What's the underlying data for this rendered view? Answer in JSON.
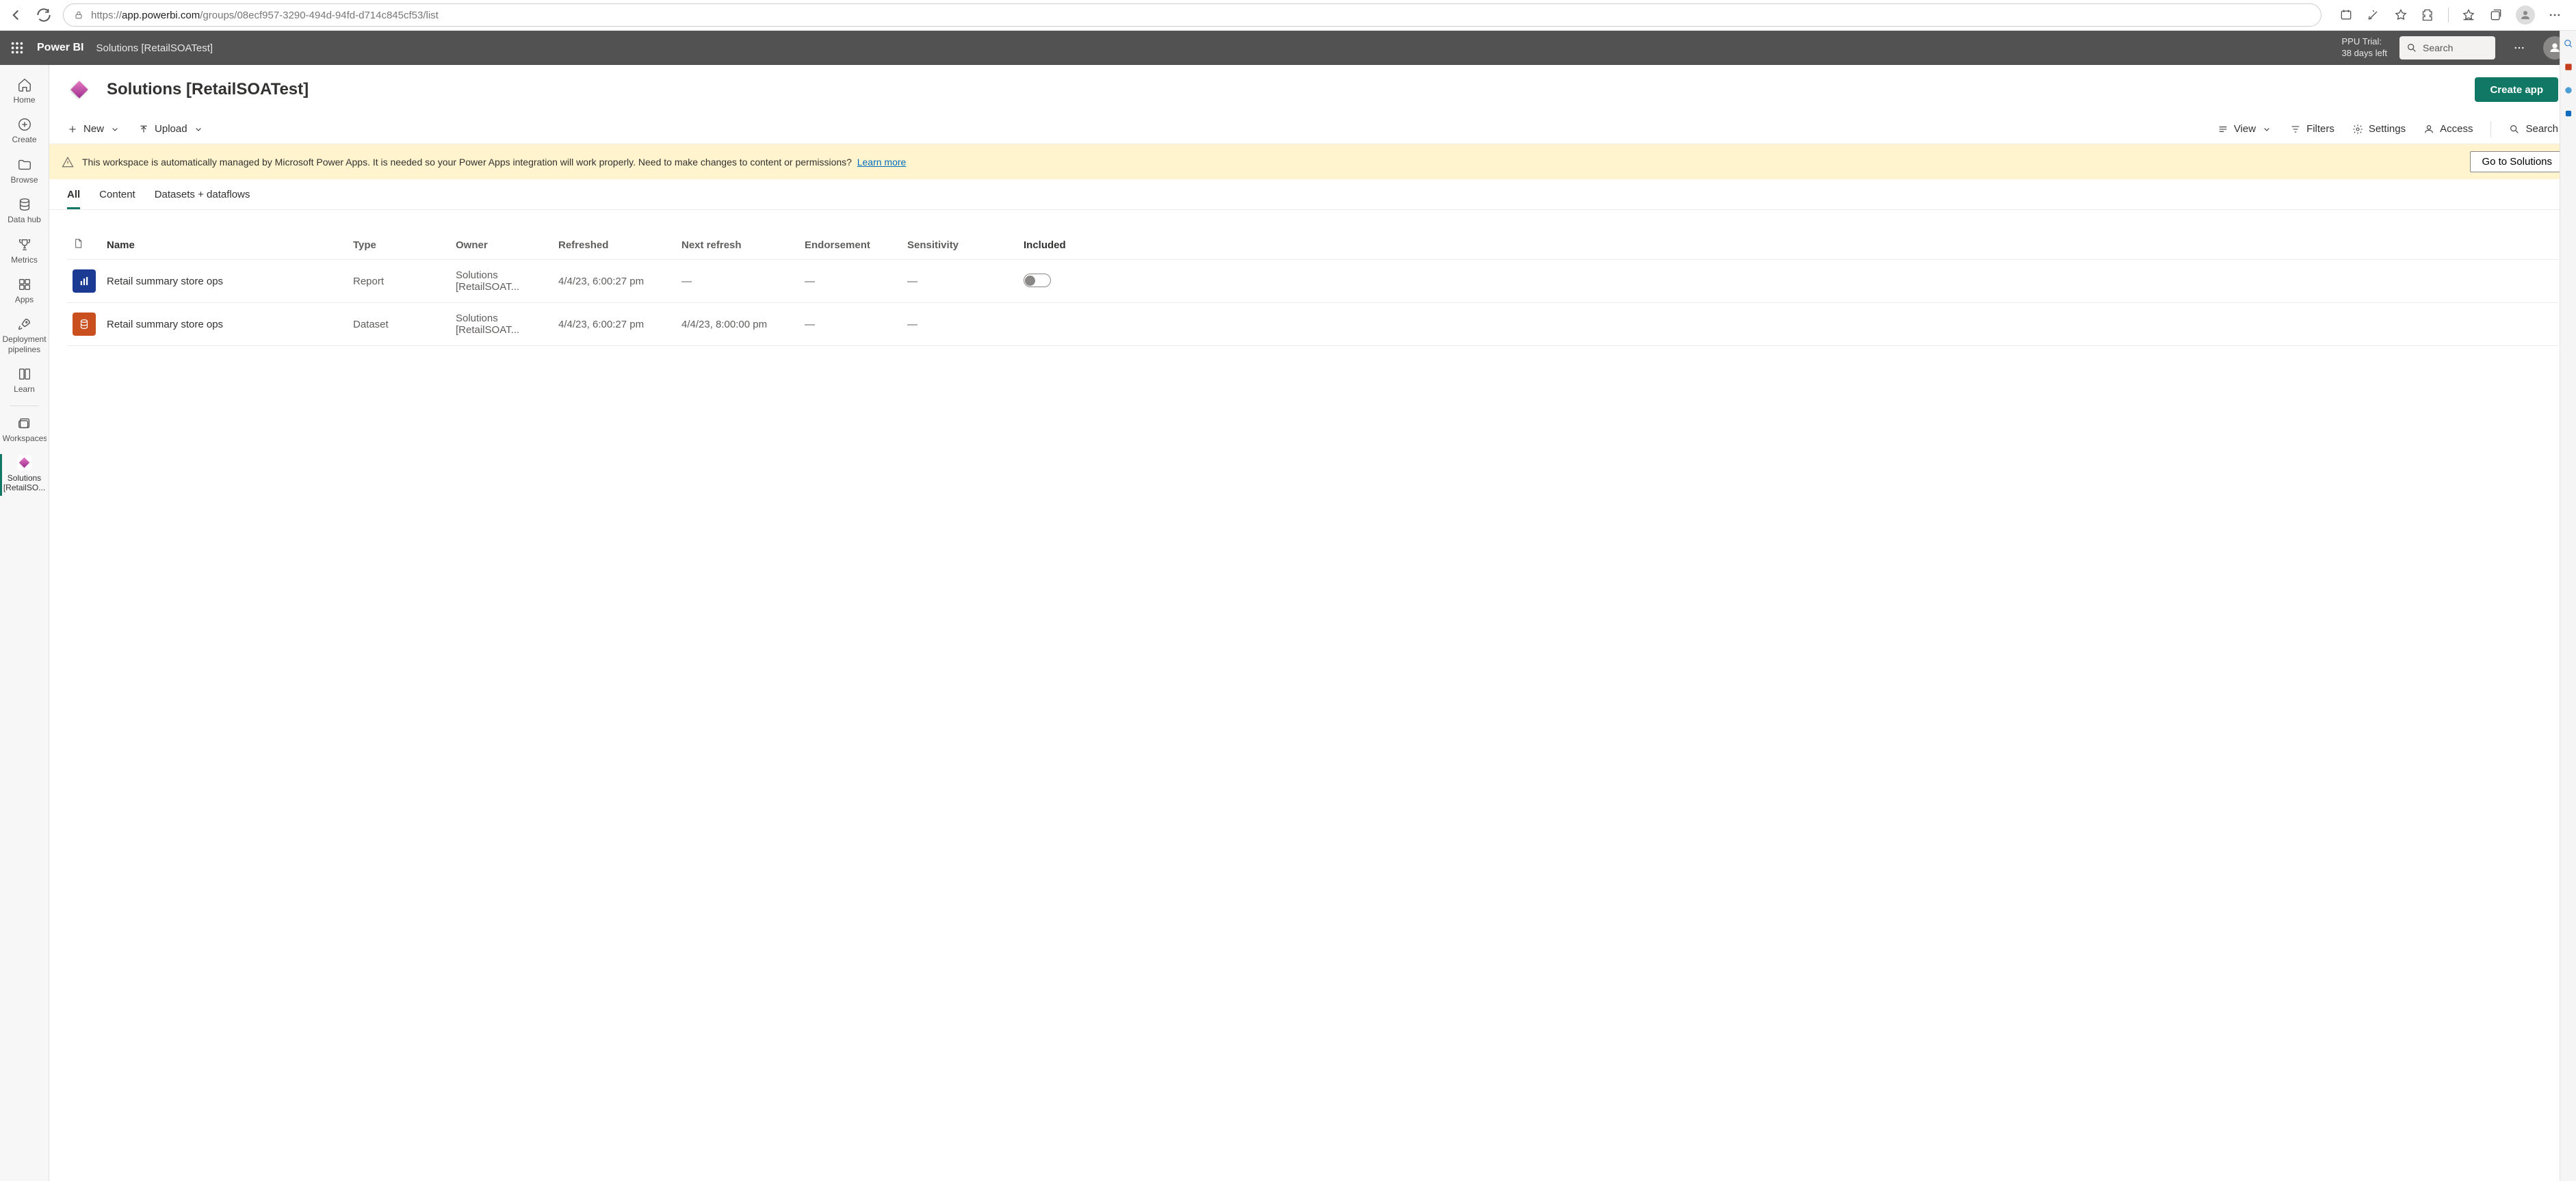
{
  "browser": {
    "url_domain": "app.powerbi.com",
    "url_path": "/groups/08ecf957-3290-494d-94fd-d714c845cf53/list"
  },
  "topbar": {
    "brand": "Power BI",
    "breadcrumb": "Solutions [RetailSOATest]",
    "trial_line1": "PPU Trial:",
    "trial_line2": "38 days left",
    "search_placeholder": "Search"
  },
  "rail": {
    "home": "Home",
    "create": "Create",
    "browse": "Browse",
    "datahub": "Data hub",
    "metrics": "Metrics",
    "apps": "Apps",
    "pipelines": "Deployment pipelines",
    "learn": "Learn",
    "workspaces": "Workspaces",
    "active_ws_line1": "Solutions",
    "active_ws_line2": "[RetailSO..."
  },
  "workspace": {
    "title": "Solutions [RetailSOATest]",
    "create_app": "Create app"
  },
  "commands": {
    "new": "New",
    "upload": "Upload",
    "view": "View",
    "filters": "Filters",
    "settings": "Settings",
    "access": "Access",
    "search": "Search"
  },
  "notice": {
    "text": "This workspace is automatically managed by Microsoft Power Apps. It is needed so your Power Apps integration will work properly. Need to make changes to content or permissions?",
    "learn_more": "Learn more",
    "button": "Go to Solutions"
  },
  "tabs": {
    "all": "All",
    "content": "Content",
    "datasets": "Datasets + dataflows"
  },
  "table": {
    "headers": {
      "name": "Name",
      "type": "Type",
      "owner": "Owner",
      "refreshed": "Refreshed",
      "next_refresh": "Next refresh",
      "endorsement": "Endorsement",
      "sensitivity": "Sensitivity",
      "included": "Included"
    },
    "rows": [
      {
        "icon": "report",
        "name": "Retail summary store ops",
        "type": "Report",
        "owner": "Solutions [RetailSOAT...",
        "refreshed": "4/4/23, 6:00:27 pm",
        "next_refresh": "—",
        "endorsement": "—",
        "sensitivity": "—",
        "included_toggle": true
      },
      {
        "icon": "dataset",
        "name": "Retail summary store ops",
        "type": "Dataset",
        "owner": "Solutions [RetailSOAT...",
        "refreshed": "4/4/23, 6:00:27 pm",
        "next_refresh": "4/4/23, 8:00:00 pm",
        "endorsement": "—",
        "sensitivity": "—",
        "included_toggle": false
      }
    ]
  }
}
